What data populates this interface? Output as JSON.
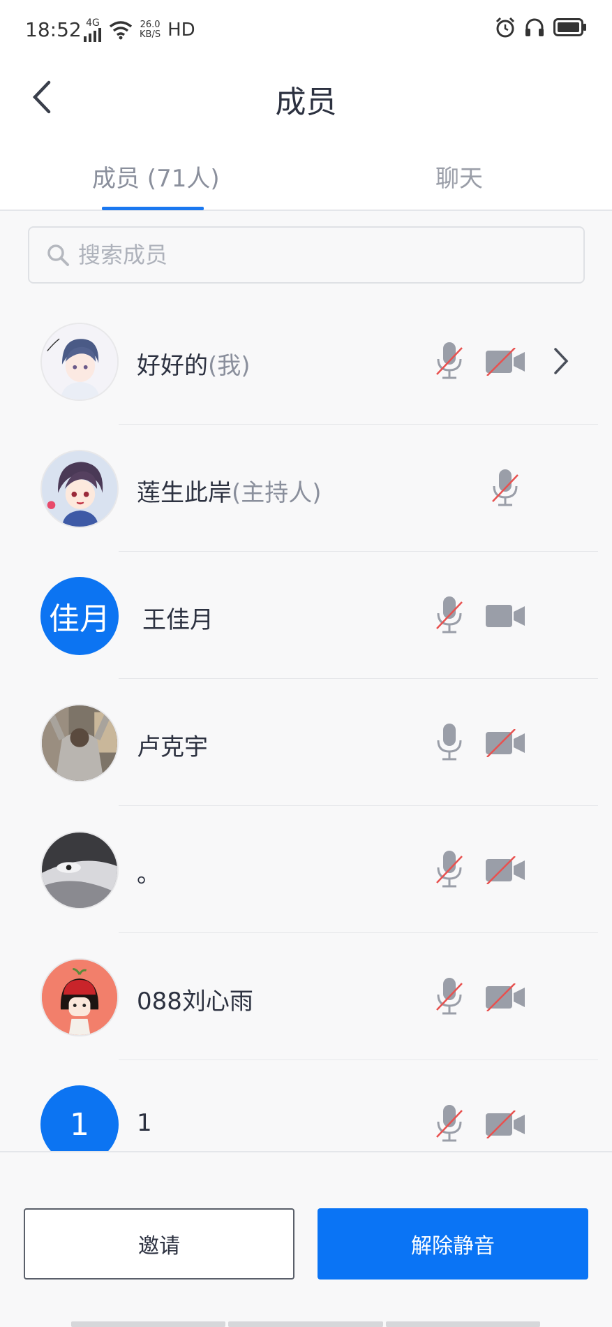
{
  "status_bar": {
    "time": "18:52",
    "network": "4G",
    "speed_value": "26.0",
    "speed_unit": "KB/S",
    "hd": "HD"
  },
  "header": {
    "title": "成员"
  },
  "tabs": [
    {
      "label": "成员 (71人)",
      "active": true
    },
    {
      "label": "聊天",
      "active": false
    }
  ],
  "search": {
    "placeholder": "搜索成员"
  },
  "members": [
    {
      "name": "好好的",
      "role": "(我)",
      "avatar_text": "",
      "avatar_type": "photo-anime-boy",
      "mic_muted": true,
      "video": "off",
      "show_chevron": true
    },
    {
      "name": "莲生此岸",
      "role": "(主持人)",
      "avatar_text": "",
      "avatar_type": "photo-anime-boy2",
      "mic_muted": true,
      "video": "none",
      "show_chevron": false
    },
    {
      "name": "王佳月",
      "role": "",
      "avatar_text": "佳月",
      "avatar_type": "text",
      "mic_muted": true,
      "video": "on",
      "show_chevron": false
    },
    {
      "name": "卢克宇",
      "role": "",
      "avatar_text": "",
      "avatar_type": "photo-street",
      "mic_muted": false,
      "video": "off",
      "show_chevron": false
    },
    {
      "name": "。",
      "role": "",
      "avatar_text": "",
      "avatar_type": "photo-grey",
      "mic_muted": true,
      "video": "off",
      "show_chevron": false
    },
    {
      "name": "088刘心雨",
      "role": "",
      "avatar_text": "",
      "avatar_type": "photo-cartoon-girl",
      "mic_muted": true,
      "video": "off",
      "show_chevron": false
    },
    {
      "name": "1",
      "role": "",
      "avatar_text": "1",
      "avatar_type": "text",
      "mic_muted": true,
      "video": "off",
      "show_chevron": false
    }
  ],
  "actions": {
    "invite_label": "邀请",
    "unmute_label": "解除静音"
  },
  "colors": {
    "accent": "#0a74f5",
    "muted_slash": "#e8514f",
    "icon_grey": "#9a9ea8"
  }
}
